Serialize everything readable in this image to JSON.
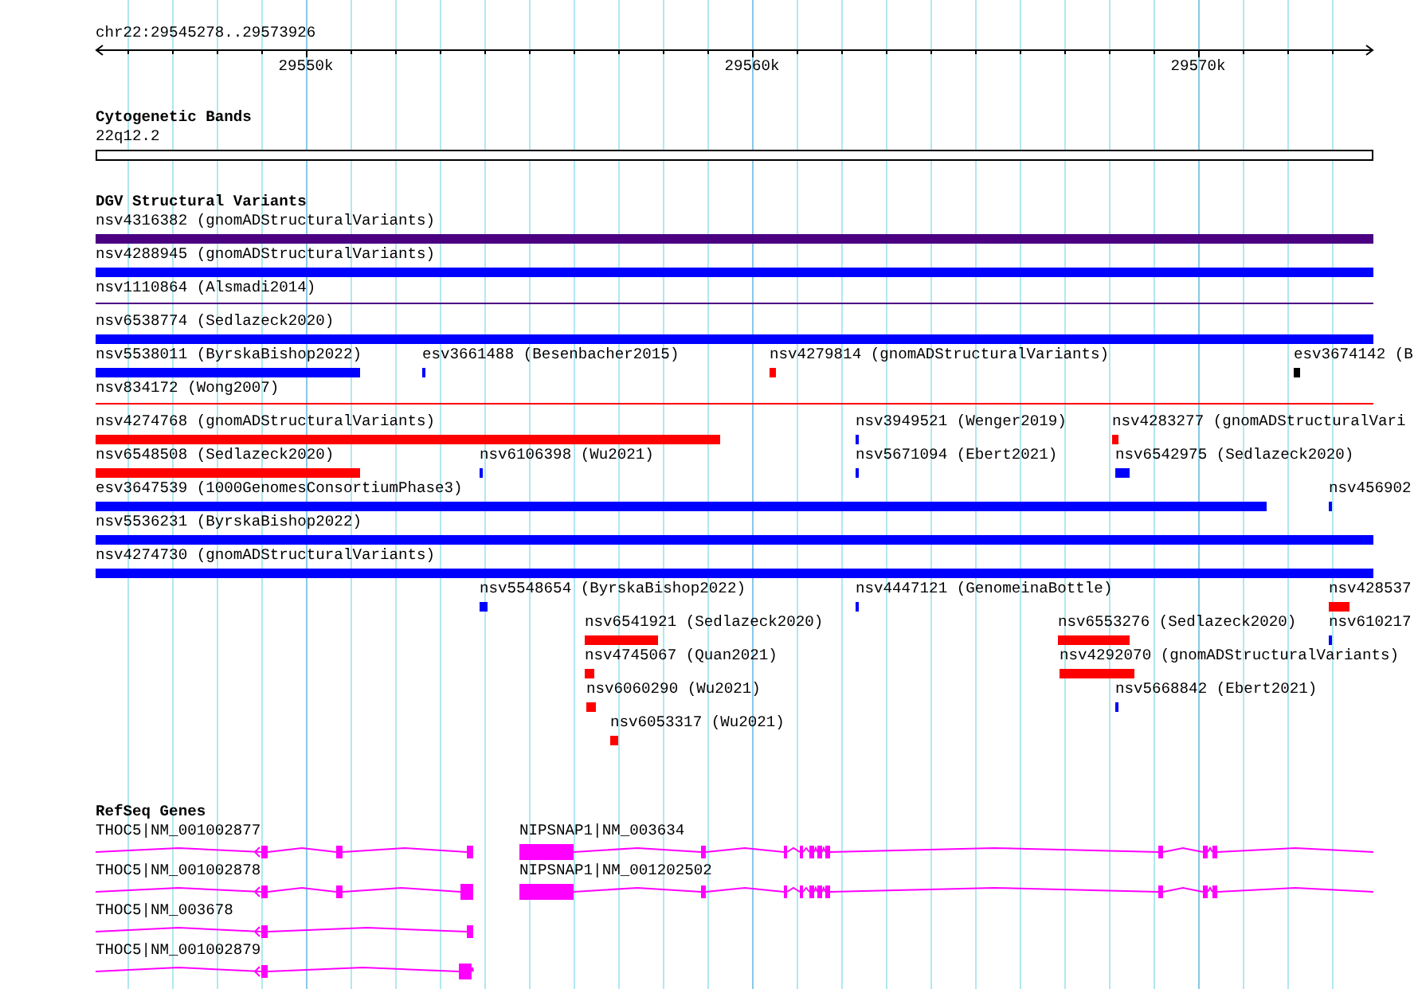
{
  "ruler": {
    "location": "chr22:29545278..29573926",
    "ticks": [
      "29550k",
      "29560k",
      "29570k"
    ]
  },
  "cytogenetic_bands": {
    "title": "Cytogenetic Bands",
    "band": "22q12.2"
  },
  "dgv": {
    "title": "DGV Structural Variants",
    "rows": [
      {
        "features": [
          {
            "label": "nsv4316382 (gnomADStructuralVariants)",
            "kind": "block",
            "color": "#4b0082"
          }
        ]
      },
      {
        "features": [
          {
            "label": "nsv4288945 (gnomADStructuralVariants)",
            "kind": "block",
            "color": "#0000ff"
          }
        ]
      },
      {
        "features": [
          {
            "label": "nsv1110864 (Alsmadi2014)",
            "kind": "line",
            "color": "#4b0082"
          }
        ]
      },
      {
        "features": [
          {
            "label": "nsv6538774 (Sedlazeck2020)",
            "kind": "block",
            "color": "#0000ff"
          }
        ]
      },
      {
        "features": [
          {
            "label": "nsv5538011 (ByrskaBishop2022)",
            "kind": "block",
            "color": "#0000ff"
          },
          {
            "label": "esv3661488 (Besenbacher2015)",
            "kind": "block",
            "color": "#0000ff"
          },
          {
            "label": "nsv4279814 (gnomADStructuralVariants)",
            "kind": "block",
            "color": "#ff0000"
          },
          {
            "label": "esv3674142 (B",
            "kind": "block",
            "color": "#000000"
          }
        ]
      },
      {
        "features": [
          {
            "label": "nsv834172 (Wong2007)",
            "kind": "line",
            "color": "#ff0000"
          }
        ]
      },
      {
        "features": [
          {
            "label": "nsv4274768 (gnomADStructuralVariants)",
            "kind": "block",
            "color": "#ff0000"
          },
          {
            "label": "nsv3949521 (Wenger2019)",
            "kind": "block",
            "color": "#0000ff"
          },
          {
            "label": "nsv4283277 (gnomADStructuralVari",
            "kind": "block",
            "color": "#ff0000"
          }
        ]
      },
      {
        "features": [
          {
            "label": "nsv6548508 (Sedlazeck2020)",
            "kind": "block",
            "color": "#ff0000"
          },
          {
            "label": "nsv6106398 (Wu2021)",
            "kind": "block",
            "color": "#0000ff"
          },
          {
            "label": "nsv5671094 (Ebert2021)",
            "kind": "block",
            "color": "#0000ff"
          },
          {
            "label": "nsv6542975 (Sedlazeck2020)",
            "kind": "block",
            "color": "#0000ff"
          }
        ]
      },
      {
        "features": [
          {
            "label": "esv3647539 (1000GenomesConsortiumPhase3)",
            "kind": "block",
            "color": "#0000ff"
          },
          {
            "label": "nsv456902",
            "kind": "block",
            "color": "#0000ff"
          }
        ]
      },
      {
        "features": [
          {
            "label": "nsv5536231 (ByrskaBishop2022)",
            "kind": "block",
            "color": "#0000ff"
          }
        ]
      },
      {
        "features": [
          {
            "label": "nsv4274730 (gnomADStructuralVariants)",
            "kind": "block",
            "color": "#0000ff"
          }
        ]
      },
      {
        "features": [
          {
            "label": "nsv5548654 (ByrskaBishop2022)",
            "kind": "block",
            "color": "#0000ff"
          },
          {
            "label": "nsv4447121 (GenomeinaBottle)",
            "kind": "block",
            "color": "#0000ff"
          },
          {
            "label": "nsv428537",
            "kind": "block",
            "color": "#ff0000"
          }
        ]
      },
      {
        "features": [
          {
            "label": "nsv6541921 (Sedlazeck2020)",
            "kind": "block",
            "color": "#ff0000"
          },
          {
            "label": "nsv6553276 (Sedlazeck2020)",
            "kind": "block",
            "color": "#ff0000"
          },
          {
            "label": "nsv610217",
            "kind": "block",
            "color": "#0000ff"
          }
        ]
      },
      {
        "features": [
          {
            "label": "nsv4745067 (Quan2021)",
            "kind": "block",
            "color": "#ff0000"
          },
          {
            "label": "nsv4292070 (gnomADStructuralVariants)",
            "kind": "block",
            "color": "#ff0000"
          }
        ]
      },
      {
        "features": [
          {
            "label": "nsv6060290 (Wu2021)",
            "kind": "block",
            "color": "#ff0000"
          },
          {
            "label": "nsv5668842 (Ebert2021)",
            "kind": "block",
            "color": "#0000ff"
          }
        ]
      },
      {
        "features": [
          {
            "label": "nsv6053317 (Wu2021)",
            "kind": "block",
            "color": "#ff0000"
          }
        ]
      }
    ]
  },
  "refseq_genes": {
    "title": "RefSeq Genes",
    "rows": [
      {
        "genes": [
          {
            "label": "THOC5|NM_001002877"
          },
          {
            "label": "NIPSNAP1|NM_003634"
          }
        ]
      },
      {
        "genes": [
          {
            "label": "THOC5|NM_001002878"
          },
          {
            "label": "NIPSNAP1|NM_001202502"
          }
        ]
      },
      {
        "genes": [
          {
            "label": "THOC5|NM_003678"
          }
        ]
      },
      {
        "genes": [
          {
            "label": "THOC5|NM_001002879"
          }
        ]
      }
    ]
  }
}
